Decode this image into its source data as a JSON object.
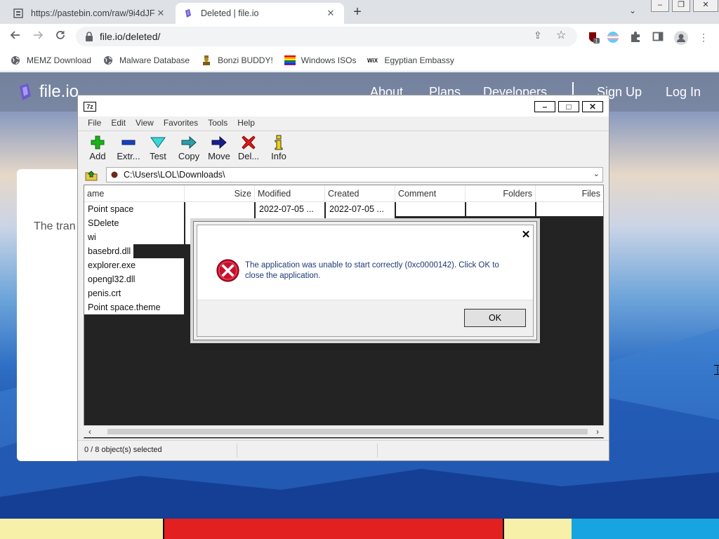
{
  "browser": {
    "tabs": [
      {
        "title": "https://pastebin.com/raw/9i4dJF",
        "close": "✕",
        "active": false
      },
      {
        "title": "Deleted | file.io",
        "close": "✕",
        "active": true
      }
    ],
    "new_tab": "+",
    "tab_search": "⌄",
    "window_controls": [
      "–",
      "❐",
      "✕"
    ],
    "url": "file.io/deleted/",
    "extension_badge": "1",
    "bookmarks": [
      {
        "label": "MEMZ Download",
        "icon": "globe-icon"
      },
      {
        "label": "Malware Database",
        "icon": "globe-icon"
      },
      {
        "label": "Bonzi BUDDY!",
        "icon": "bonzi-icon"
      },
      {
        "label": "Windows ISOs",
        "icon": "windows-flag-icon"
      },
      {
        "label": "Egyptian Embassy",
        "icon": "wix-icon"
      }
    ]
  },
  "site": {
    "logo": "file.io",
    "nav": [
      "About",
      "Plans",
      "Developers",
      "Sign Up",
      "Log In"
    ],
    "card_text": "The tran been de"
  },
  "sevenzip": {
    "logo": "7z",
    "menu": [
      "File",
      "Edit",
      "View",
      "Favorites",
      "Tools",
      "Help"
    ],
    "tools": [
      "Add",
      "Extr...",
      "Test",
      "Copy",
      "Move",
      "Del...",
      "Info"
    ],
    "path": "C:\\Users\\LOL\\Downloads\\",
    "columns": [
      "ame",
      "Size",
      "Modified",
      "Created",
      "Comment",
      "Folders",
      "Files"
    ],
    "rows": [
      {
        "name": "Point space",
        "modified": "2022-07-05 ...",
        "created": "2022-07-05 ..."
      },
      {
        "name": "SDelete",
        "modified": "",
        "created": ""
      },
      {
        "name": "wi",
        "modified": "",
        "created": ""
      },
      {
        "name": "basebrd.dll",
        "modified": "",
        "created": ""
      },
      {
        "name": "explorer.exe",
        "modified": "",
        "created": ""
      },
      {
        "name": "opengl32.dll",
        "modified": "",
        "created": ""
      },
      {
        "name": "penis.crt",
        "modified": "",
        "created": ""
      },
      {
        "name": "Point space.theme",
        "modified": "",
        "created": ""
      }
    ],
    "status": "0 / 8 object(s) selected"
  },
  "dialog": {
    "close": "✕",
    "message": "The application was unable to start correctly (0xc0000142). Click OK to close the application.",
    "ok": "OK"
  },
  "colors": {
    "chrome_tabstrip": "#dee1e6",
    "error_red": "#c8102e",
    "dialog_text": "#1e3a78",
    "list_background": "#232324"
  }
}
